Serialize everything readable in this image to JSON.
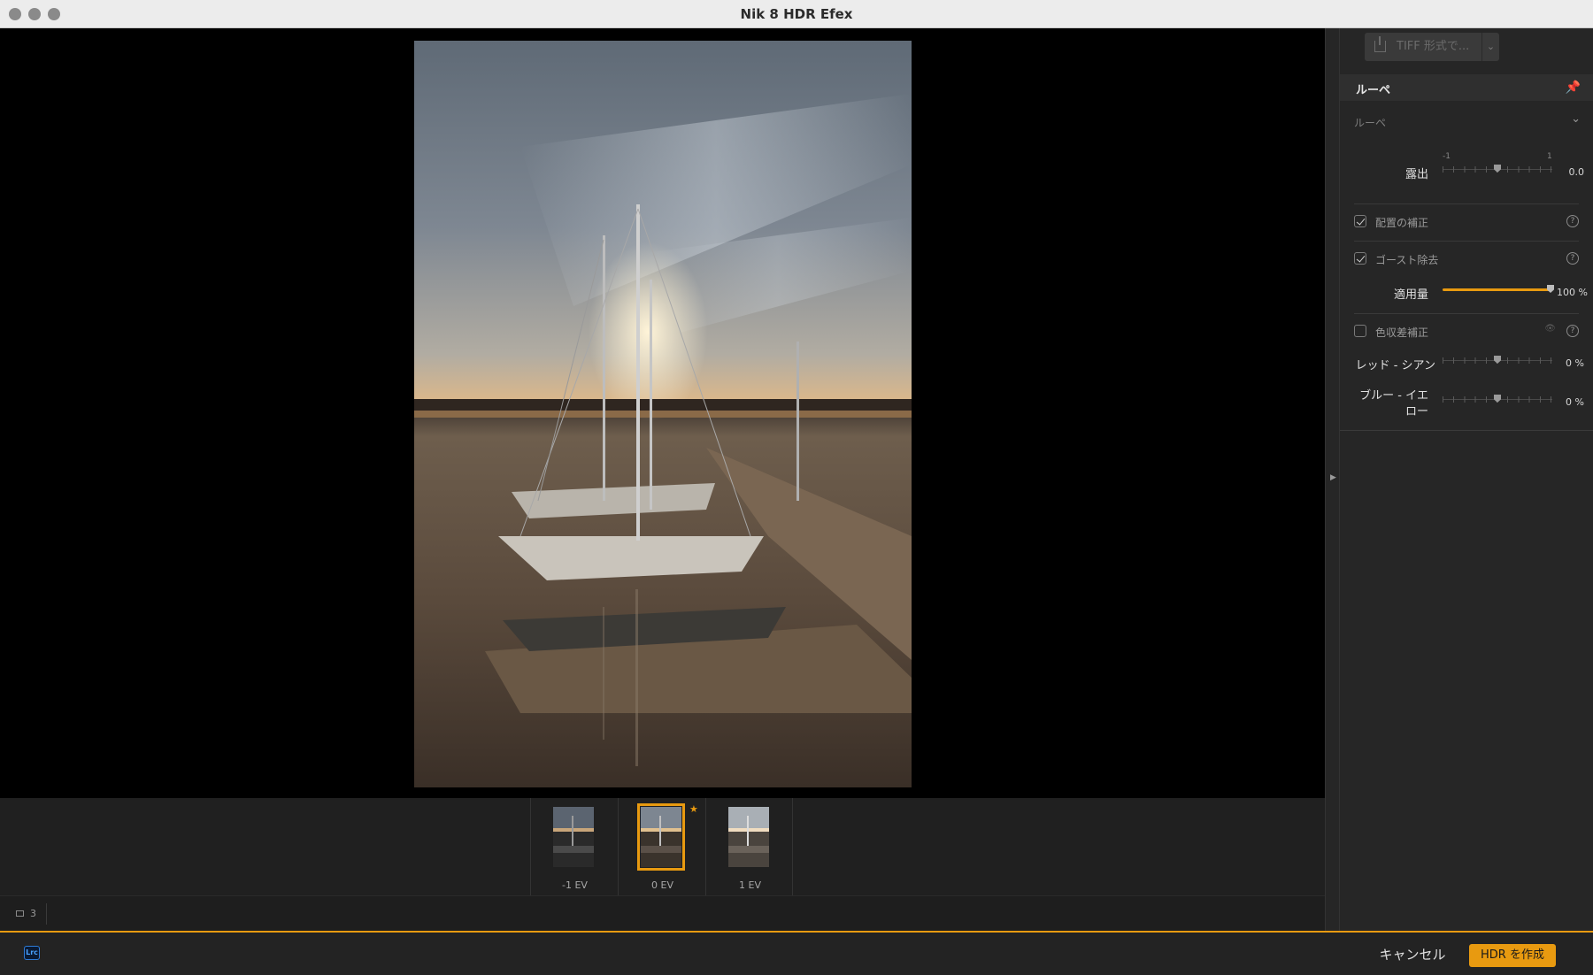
{
  "window": {
    "title": "Nik 8 HDR Efex"
  },
  "toolbar": {
    "export_label": "TIFF 形式で..."
  },
  "panel": {
    "section_title": "ルーペ",
    "sub_title": "ルーペ",
    "exposure": {
      "label": "露出",
      "min_label": "-1",
      "max_label": "1",
      "value_text": "0.0",
      "value": 0.0
    },
    "alignment": {
      "label": "配置の補正",
      "checked": true
    },
    "ghost": {
      "label": "ゴースト除去",
      "checked": true
    },
    "amount": {
      "label": "適用量",
      "value_text": "100 %",
      "value": 100
    },
    "chromatic": {
      "label": "色収差補正",
      "checked": false
    },
    "red_cyan": {
      "label": "レッド - シアン",
      "value_text": "0 %",
      "value": 0
    },
    "blue_yellow": {
      "label_line1": "ブルー - イエ",
      "label_line2": "ロー",
      "value_text": "0 %",
      "value": 0
    },
    "help_glyph": "?"
  },
  "filmstrip": {
    "items": [
      {
        "label": "-1 EV",
        "selected": false
      },
      {
        "label": "0 EV",
        "selected": true
      },
      {
        "label": "1 EV",
        "selected": false
      }
    ]
  },
  "count": {
    "value": "3"
  },
  "footer": {
    "host_badge": "Lrc",
    "cancel_label": "キャンセル",
    "create_label": "HDR を作成"
  },
  "colors": {
    "accent": "#e89a10",
    "panel_bg": "#262626",
    "canvas_bg": "#000000"
  },
  "icons": [
    "upload-icon",
    "chevron-down-icon",
    "pin-icon",
    "help-icon",
    "eye-icon",
    "image-icon",
    "star-icon",
    "collapse-arrow-icon"
  ]
}
